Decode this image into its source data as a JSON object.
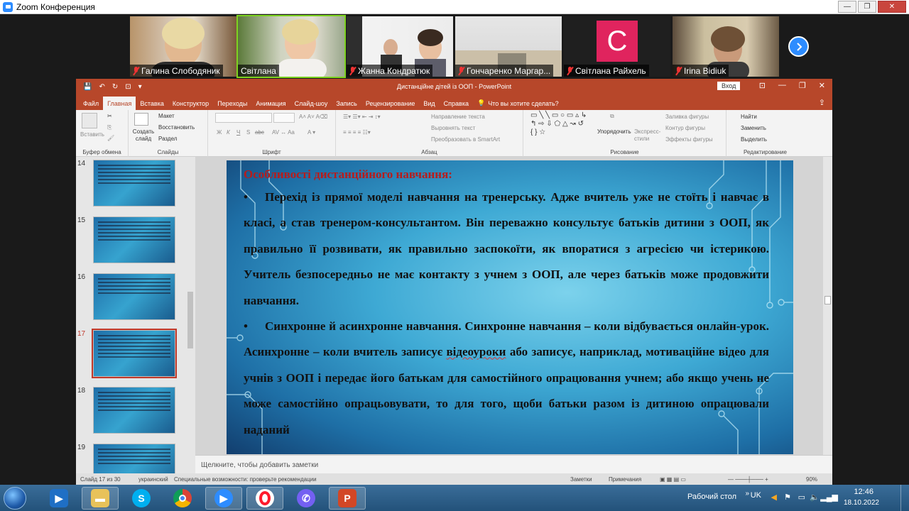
{
  "zoom": {
    "title": "Zoom Конференция",
    "participants": [
      {
        "name": "Галина Слободяник",
        "muted": true
      },
      {
        "name": "Світлана",
        "muted": false,
        "active": true
      },
      {
        "name": "Жанна Кондратюк",
        "muted": true
      },
      {
        "name": "Гончаренко Маргар...",
        "muted": true
      },
      {
        "name": "Світлана Райхель",
        "muted": true,
        "avatar_letter": "C",
        "avatar_color": "#e0245e"
      },
      {
        "name": "Irina Bidiuk",
        "muted": true
      }
    ]
  },
  "ppt": {
    "quick_access": [
      "💾",
      "↶",
      "↻",
      "⊡",
      "▾"
    ],
    "doc_title": "Дистанційне дітей із ООП - PowerPoint",
    "signin": "Вход",
    "tabs": [
      "Файл",
      "Главная",
      "Вставка",
      "Конструктор",
      "Переходы",
      "Анимация",
      "Слайд-шоу",
      "Запись",
      "Рецензирование",
      "Вид",
      "Справка"
    ],
    "active_tab": "Главная",
    "tell_me": "Что вы хотите сделать?",
    "ribbon": {
      "paste": "Вставить",
      "clipboard": "Буфер обмена",
      "new_slide": "Создать слайд",
      "layout": "Макет",
      "reset": "Восстановить",
      "section": "Раздел",
      "slides": "Слайды",
      "font": "Шрифт",
      "bold": "Ж",
      "italic": "К",
      "underline": "Ч",
      "strike": "S",
      "shadow": "abc",
      "text_direction": "Направление текста",
      "align_text": "Выровнять текст",
      "smartart": "Преобразовать в SmartArt",
      "paragraph": "Абзац",
      "arrange": "Упорядочить",
      "quick_styles": "Экспресс-стили",
      "shape_fill": "Заливка фигуры",
      "shape_outline": "Контур фигуры",
      "shape_effects": "Эффекты фигуры",
      "drawing": "Рисование",
      "find": "Найти",
      "replace": "Заменить",
      "select": "Выделить",
      "editing": "Редактирование"
    },
    "thumbnails": [
      {
        "num": "14",
        "selected": false
      },
      {
        "num": "15",
        "selected": false
      },
      {
        "num": "16",
        "selected": false
      },
      {
        "num": "17",
        "selected": true
      },
      {
        "num": "18",
        "selected": false
      },
      {
        "num": "19",
        "selected": false
      }
    ],
    "slide": {
      "heading": "Особливості дистанційного навчання:",
      "bullet": "•",
      "p1": "Перехід із прямої моделі навчання на тренерську. Адже вчитель уже не стоїть і навчає в класі, а став тренером-консультантом. Він переважно консультує батьків дитини з ООП, як правильно її розвивати, як правильно заспокоїти, як впоратися з агресією чи істерикою. Учитель безпосередньо не має контакту з учнем з ООП, але через батьків може продовжити навчання.",
      "p2_a": "Синхронне й асинхронне навчання. Синхронне навчання – коли відбувається онлайн-урок. Асинхронне – коли вчитель записує ",
      "p2_spell": "відеоуроки",
      "p2_b": " або записує, наприклад, мотиваційне відео для учнів з ООП і передає його батькам для самостійного опрацювання учнем; або якщо учень не може самостійно опрацьовувати, то для того, щоби батьки разом із дитиною опрацювали наданий"
    },
    "notes_placeholder": "Щелкните, чтобы добавить заметки",
    "status": {
      "slide_of": "Слайд 17 из 30",
      "lang": "украинский",
      "accessibility": "Специальные возможности: проверьте рекомендации",
      "notes": "Заметки",
      "comments": "Примечания",
      "zoom": "90%"
    }
  },
  "taskbar": {
    "desktop": "Рабочий стол",
    "lang": "UK",
    "time": "12:46",
    "date": "18.10.2022"
  }
}
